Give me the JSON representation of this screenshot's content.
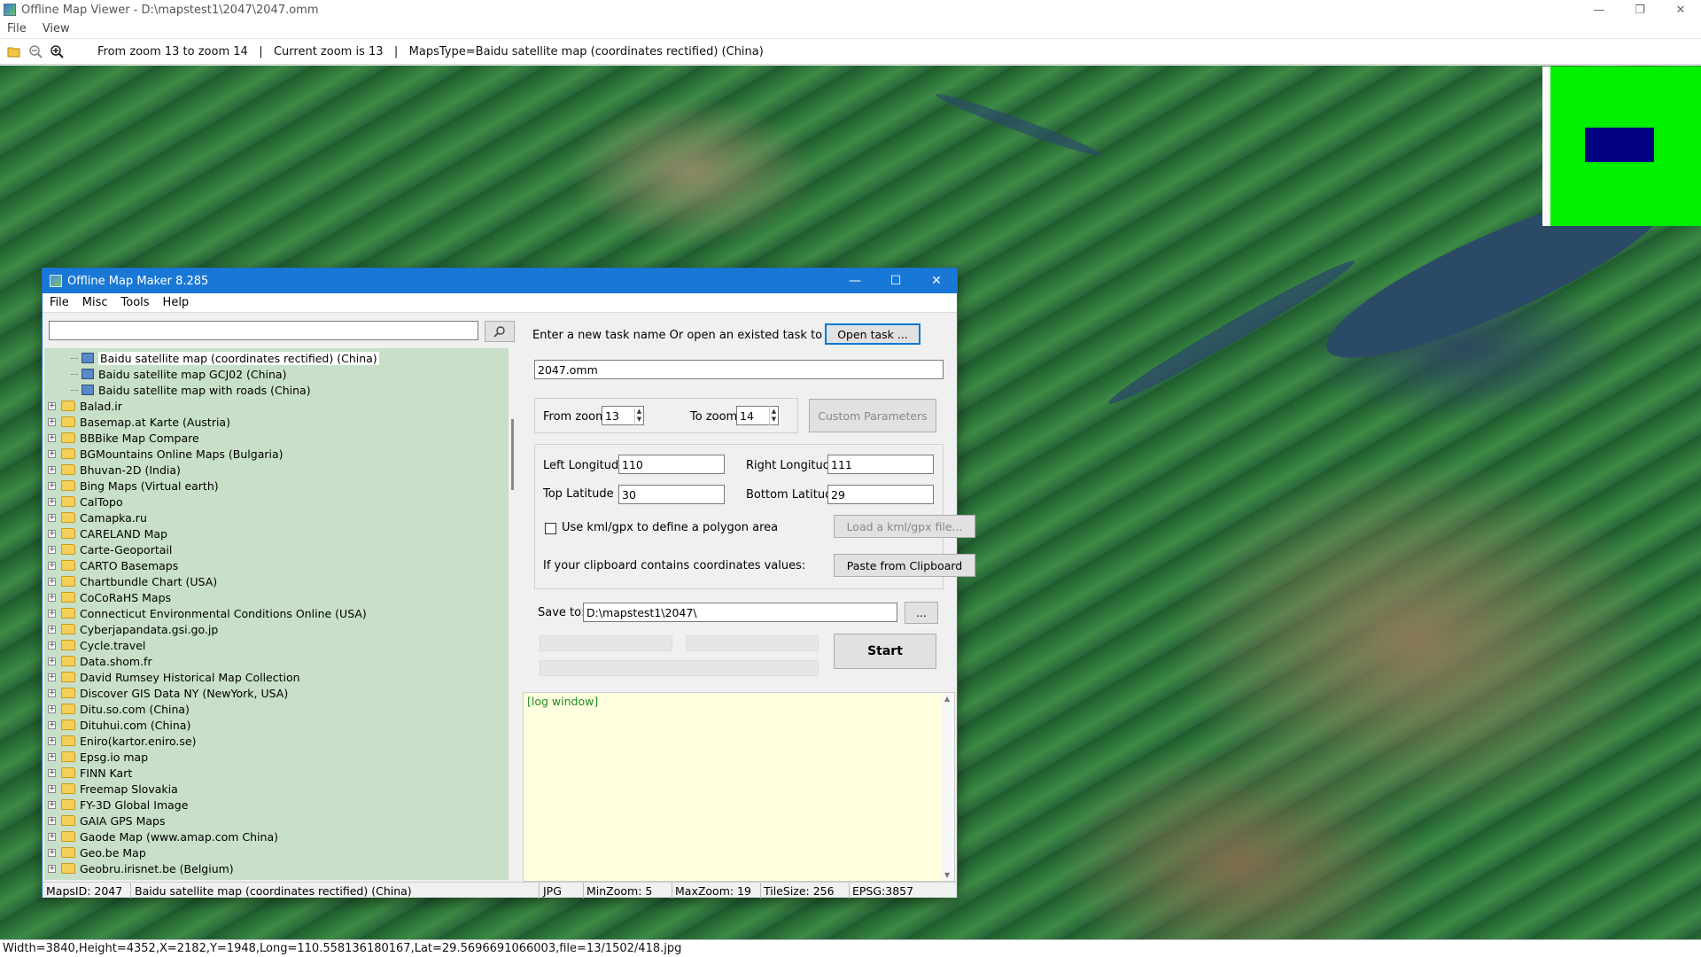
{
  "viewer": {
    "title": "Offline Map Viewer - D:\\mapstest1\\2047\\2047.omm",
    "menu": [
      "File",
      "View"
    ],
    "toolbar_info": "From zoom 13 to zoom 14   |   Current zoom is 13   |   MapsType=Baidu satellite map (coordinates rectified) (China)",
    "status": "Width=3840,Height=4352,X=2182,Y=1948,Long=110.558136180167,Lat=29.5696691066003,file=13/1502/418.jpg",
    "window_controls": [
      "—",
      "❐",
      "✕"
    ]
  },
  "dialog": {
    "title": "Offline Map Maker 8.285",
    "menu": [
      "File",
      "Misc",
      "Tools",
      "Help"
    ],
    "controls": [
      "—",
      "☐",
      "✕"
    ],
    "search": {
      "value": "",
      "placeholder": ""
    },
    "tree": {
      "children": [
        "Baidu satellite map (coordinates rectified) (China)",
        "Baidu satellite map GCJ02 (China)",
        "Baidu satellite map with roads (China)"
      ],
      "folders": [
        "Balad.ir",
        "Basemap.at Karte (Austria)",
        "BBBike Map Compare",
        "BGMountains Online Maps (Bulgaria)",
        "Bhuvan-2D (India)",
        "Bing Maps (Virtual earth)",
        "CalTopo",
        "Camapka.ru",
        "CARELAND Map",
        "Carte-Geoportail",
        "CARTO Basemaps",
        "Chartbundle Chart (USA)",
        "CoCoRaHS Maps",
        "Connecticut Environmental Conditions Online (USA)",
        "Cyberjapandata.gsi.go.jp",
        "Cycle.travel",
        "Data.shom.fr",
        "David Rumsey Historical Map Collection",
        "Discover GIS Data NY (NewYork, USA)",
        "Ditu.so.com (China)",
        "Dituhui.com (China)",
        "Eniro(kartor.eniro.se)",
        "Epsg.io map",
        "FINN Kart",
        "Freemap Slovakia",
        "FY-3D Global Image",
        "GAIA GPS Maps",
        "Gaode Map (www.amap.com China)",
        "Geo.be Map",
        "Geobru.irisnet.be (Belgium)"
      ]
    },
    "task": {
      "prompt": "Enter a new task name Or open an existed task to continue:",
      "open_button": "Open task ...",
      "task_name": "2047.omm"
    },
    "zoom": {
      "from_label": "From zoom",
      "from_value": "13",
      "to_label": "To zoom",
      "to_value": "14",
      "custom_button": "Custom Parameters"
    },
    "coords": {
      "left_lon_label": "Left Longitude",
      "left_lon": "110",
      "right_lon_label": "Right Longitude",
      "right_lon": "111",
      "top_lat_label": "Top Latitude",
      "top_lat": "30",
      "bottom_lat_label": "Bottom Latitude",
      "bottom_lat": "29",
      "kml_check_label": "Use kml/gpx to define a polygon area",
      "kml_button": "Load a kml/gpx file...",
      "clipboard_label": "If your clipboard contains coordinates values:",
      "clipboard_button": "Paste from Clipboard"
    },
    "save": {
      "label": "Save to:",
      "path": "D:\\mapstest1\\2047\\",
      "browse": "..."
    },
    "start_button": "Start",
    "log": "[log window]",
    "status": {
      "maps_id": "MapsID: 2047",
      "maps_name": "Baidu satellite map (coordinates rectified) (China)",
      "format": "JPG",
      "min_zoom": "MinZoom: 5",
      "max_zoom": "MaxZoom: 19",
      "tile_size": "TileSize: 256",
      "epsg": "EPSG:3857"
    }
  }
}
